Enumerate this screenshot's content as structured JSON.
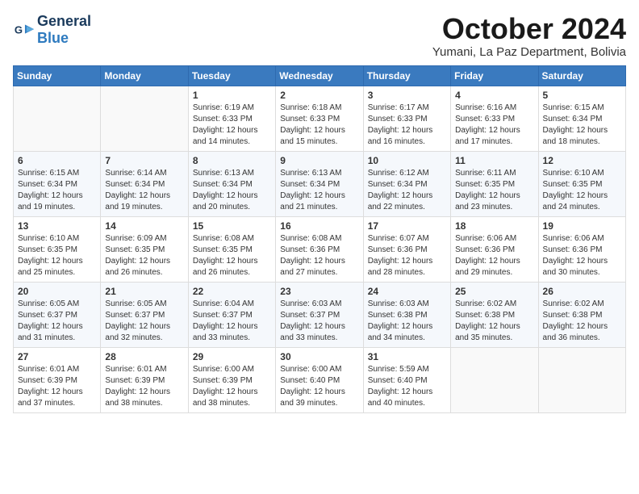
{
  "header": {
    "logo_general": "General",
    "logo_blue": "Blue",
    "month": "October 2024",
    "location": "Yumani, La Paz Department, Bolivia"
  },
  "weekdays": [
    "Sunday",
    "Monday",
    "Tuesday",
    "Wednesday",
    "Thursday",
    "Friday",
    "Saturday"
  ],
  "weeks": [
    [
      null,
      null,
      {
        "day": "1",
        "sunrise": "6:19 AM",
        "sunset": "6:33 PM",
        "daylight": "12 hours and 14 minutes."
      },
      {
        "day": "2",
        "sunrise": "6:18 AM",
        "sunset": "6:33 PM",
        "daylight": "12 hours and 15 minutes."
      },
      {
        "day": "3",
        "sunrise": "6:17 AM",
        "sunset": "6:33 PM",
        "daylight": "12 hours and 16 minutes."
      },
      {
        "day": "4",
        "sunrise": "6:16 AM",
        "sunset": "6:33 PM",
        "daylight": "12 hours and 17 minutes."
      },
      {
        "day": "5",
        "sunrise": "6:15 AM",
        "sunset": "6:34 PM",
        "daylight": "12 hours and 18 minutes."
      }
    ],
    [
      {
        "day": "6",
        "sunrise": "6:15 AM",
        "sunset": "6:34 PM",
        "daylight": "12 hours and 19 minutes."
      },
      {
        "day": "7",
        "sunrise": "6:14 AM",
        "sunset": "6:34 PM",
        "daylight": "12 hours and 19 minutes."
      },
      {
        "day": "8",
        "sunrise": "6:13 AM",
        "sunset": "6:34 PM",
        "daylight": "12 hours and 20 minutes."
      },
      {
        "day": "9",
        "sunrise": "6:13 AM",
        "sunset": "6:34 PM",
        "daylight": "12 hours and 21 minutes."
      },
      {
        "day": "10",
        "sunrise": "6:12 AM",
        "sunset": "6:34 PM",
        "daylight": "12 hours and 22 minutes."
      },
      {
        "day": "11",
        "sunrise": "6:11 AM",
        "sunset": "6:35 PM",
        "daylight": "12 hours and 23 minutes."
      },
      {
        "day": "12",
        "sunrise": "6:10 AM",
        "sunset": "6:35 PM",
        "daylight": "12 hours and 24 minutes."
      }
    ],
    [
      {
        "day": "13",
        "sunrise": "6:10 AM",
        "sunset": "6:35 PM",
        "daylight": "12 hours and 25 minutes."
      },
      {
        "day": "14",
        "sunrise": "6:09 AM",
        "sunset": "6:35 PM",
        "daylight": "12 hours and 26 minutes."
      },
      {
        "day": "15",
        "sunrise": "6:08 AM",
        "sunset": "6:35 PM",
        "daylight": "12 hours and 26 minutes."
      },
      {
        "day": "16",
        "sunrise": "6:08 AM",
        "sunset": "6:36 PM",
        "daylight": "12 hours and 27 minutes."
      },
      {
        "day": "17",
        "sunrise": "6:07 AM",
        "sunset": "6:36 PM",
        "daylight": "12 hours and 28 minutes."
      },
      {
        "day": "18",
        "sunrise": "6:06 AM",
        "sunset": "6:36 PM",
        "daylight": "12 hours and 29 minutes."
      },
      {
        "day": "19",
        "sunrise": "6:06 AM",
        "sunset": "6:36 PM",
        "daylight": "12 hours and 30 minutes."
      }
    ],
    [
      {
        "day": "20",
        "sunrise": "6:05 AM",
        "sunset": "6:37 PM",
        "daylight": "12 hours and 31 minutes."
      },
      {
        "day": "21",
        "sunrise": "6:05 AM",
        "sunset": "6:37 PM",
        "daylight": "12 hours and 32 minutes."
      },
      {
        "day": "22",
        "sunrise": "6:04 AM",
        "sunset": "6:37 PM",
        "daylight": "12 hours and 33 minutes."
      },
      {
        "day": "23",
        "sunrise": "6:03 AM",
        "sunset": "6:37 PM",
        "daylight": "12 hours and 33 minutes."
      },
      {
        "day": "24",
        "sunrise": "6:03 AM",
        "sunset": "6:38 PM",
        "daylight": "12 hours and 34 minutes."
      },
      {
        "day": "25",
        "sunrise": "6:02 AM",
        "sunset": "6:38 PM",
        "daylight": "12 hours and 35 minutes."
      },
      {
        "day": "26",
        "sunrise": "6:02 AM",
        "sunset": "6:38 PM",
        "daylight": "12 hours and 36 minutes."
      }
    ],
    [
      {
        "day": "27",
        "sunrise": "6:01 AM",
        "sunset": "6:39 PM",
        "daylight": "12 hours and 37 minutes."
      },
      {
        "day": "28",
        "sunrise": "6:01 AM",
        "sunset": "6:39 PM",
        "daylight": "12 hours and 38 minutes."
      },
      {
        "day": "29",
        "sunrise": "6:00 AM",
        "sunset": "6:39 PM",
        "daylight": "12 hours and 38 minutes."
      },
      {
        "day": "30",
        "sunrise": "6:00 AM",
        "sunset": "6:40 PM",
        "daylight": "12 hours and 39 minutes."
      },
      {
        "day": "31",
        "sunrise": "5:59 AM",
        "sunset": "6:40 PM",
        "daylight": "12 hours and 40 minutes."
      },
      null,
      null
    ]
  ],
  "labels": {
    "sunrise_prefix": "Sunrise: ",
    "sunset_prefix": "Sunset: ",
    "daylight_prefix": "Daylight: "
  }
}
